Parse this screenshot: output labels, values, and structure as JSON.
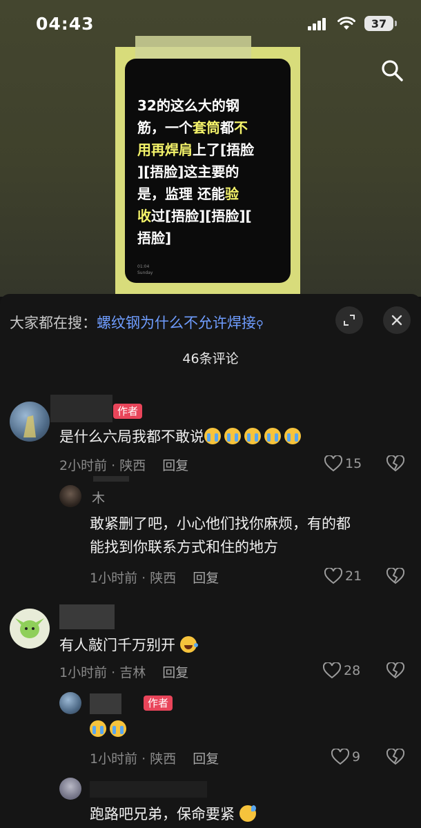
{
  "status_bar": {
    "time": "04:43",
    "battery": "37"
  },
  "video": {
    "text_lines": [
      [
        {
          "t": "32的这么大的钢",
          "hl": false
        }
      ],
      [
        {
          "t": "筋，一个",
          "hl": false
        },
        {
          "t": "套筒",
          "hl": true
        },
        {
          "t": "都",
          "hl": false
        },
        {
          "t": "不",
          "hl": true
        }
      ],
      [
        {
          "t": "用再焊肩",
          "hl": true
        },
        {
          "t": "上了[捂脸",
          "hl": false
        }
      ],
      [
        {
          "t": "][捂脸]这主要的",
          "hl": false
        }
      ],
      [
        {
          "t": "是，监理  还能",
          "hl": false
        },
        {
          "t": "验",
          "hl": true
        }
      ],
      [
        {
          "t": "收",
          "hl": true
        },
        {
          "t": "过[捂脸][捂脸][",
          "hl": false
        }
      ],
      [
        {
          "t": "捂脸]",
          "hl": false
        }
      ]
    ],
    "meta_time": "01:04",
    "meta_day": "Sunday"
  },
  "panel": {
    "hot_search_prefix": "大家都在搜：",
    "hot_search_keyword": "螺纹钢为什么不允许焊接",
    "comment_count": "46条评论"
  },
  "comments": {
    "c1": {
      "badge": "作者",
      "text": "是什么六局我都不敢说",
      "time": "2小时前 · 陕西",
      "reply": "回复",
      "likes": "15"
    },
    "c1r1": {
      "name": "木",
      "text_line1": "敢紧删了吧，小心他们找你麻烦，有的都",
      "text_line2": "能找到你联系方式和住的地方",
      "time": "1小时前 · 陕西",
      "reply": "回复",
      "likes": "21"
    },
    "c2": {
      "text": "有人敲门千万别开",
      "time": "1小时前 · 吉林",
      "reply": "回复",
      "likes": "28"
    },
    "c2r1": {
      "badge": "作者",
      "time": "1小时前 · 陕西",
      "reply": "回复",
      "likes": "9"
    },
    "c2r2": {
      "text": "跑路吧兄弟，保命要紧"
    }
  },
  "colors": {
    "accent_link": "#6f9dff",
    "author_badge": "#e9455a",
    "highlight": "#f4f36a"
  }
}
